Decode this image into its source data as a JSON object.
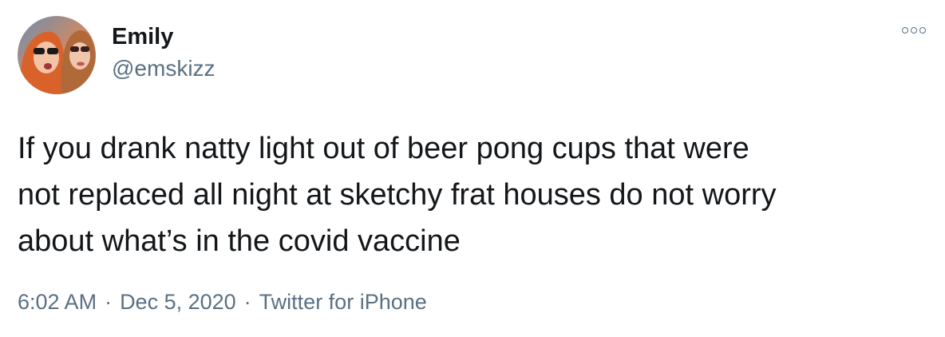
{
  "user": {
    "display_name": "Emily",
    "handle": "@emskizz",
    "avatar_icon": "profile-photo-avatar"
  },
  "tweet": {
    "lines": [
      "If you drank natty light out of beer pong cups that were",
      "not replaced all night at sketchy frat houses do not worry",
      "about what’s in the covid vaccine"
    ]
  },
  "meta": {
    "time": "6:02 AM",
    "separator": "·",
    "date": "Dec 5, 2020",
    "source": "Twitter for iPhone"
  },
  "icons": {
    "more": "more-options-icon"
  },
  "colors": {
    "text": "#14171a",
    "secondary": "#5b7083",
    "background": "#ffffff"
  }
}
